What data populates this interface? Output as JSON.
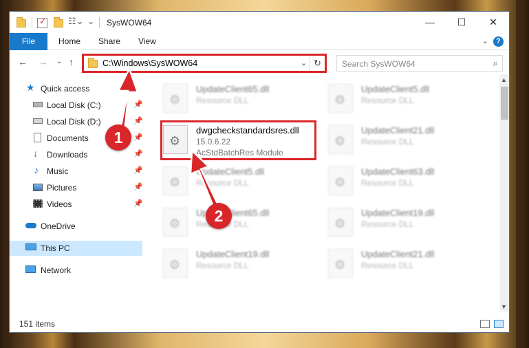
{
  "window": {
    "title": "SysWOW64",
    "controls": {
      "minimize": "—",
      "maximize": "☐",
      "close": "✕"
    }
  },
  "ribbon": {
    "tabs": [
      {
        "label": "File",
        "active": true
      },
      {
        "label": "Home"
      },
      {
        "label": "Share"
      },
      {
        "label": "View"
      }
    ],
    "help": "?",
    "collapse": "⌄"
  },
  "nav": {
    "back": "←",
    "forward": "→",
    "recent": "⌄",
    "up": "↑",
    "address": "C:\\Windows\\SysWOW64",
    "address_dropdown": "⌄",
    "refresh": "↻",
    "search_placeholder": "Search SysWOW64",
    "search_icon": "⌕"
  },
  "sidebar": {
    "items": [
      {
        "label": "Quick access",
        "icon": "star-icon",
        "pinned": false
      },
      {
        "label": "Local Disk (C:)",
        "icon": "drive-icon",
        "pinned": true
      },
      {
        "label": "Local Disk (D:)",
        "icon": "drive-icon",
        "pinned": true
      },
      {
        "label": "Documents",
        "icon": "documents-icon",
        "pinned": true
      },
      {
        "label": "Downloads",
        "icon": "download-icon",
        "pinned": true
      },
      {
        "label": "Music",
        "icon": "music-icon",
        "pinned": true
      },
      {
        "label": "Pictures",
        "icon": "pictures-icon",
        "pinned": true
      },
      {
        "label": "Videos",
        "icon": "videos-icon",
        "pinned": true
      },
      {
        "label": "OneDrive",
        "icon": "cloud-icon",
        "pinned": false
      },
      {
        "label": "This PC",
        "icon": "computer-icon",
        "pinned": false,
        "selected": true
      },
      {
        "label": "Network",
        "icon": "network-icon",
        "pinned": false
      }
    ],
    "pin_glyph": "📌"
  },
  "files": {
    "left": [
      {
        "name": "UpdateClient65.dll",
        "type": "Resource DLL",
        "blurred": true
      },
      {
        "name": "dwgcheckstandardsres.dll",
        "type": "15.0.6.22",
        "desc": "AcStdBatchRes Module",
        "blurred": false
      },
      {
        "name": "UpdateClient5.dll",
        "type": "Resource DLL",
        "blurred": true
      },
      {
        "name": "UpdateClient65.dll",
        "type": "Resource DLL",
        "blurred": true
      },
      {
        "name": "UpdateClient19.dll",
        "type": "Resource DLL",
        "blurred": true
      }
    ],
    "right": [
      {
        "name": "UpdateClient5.dll",
        "type": "Resource DLL",
        "blurred": true
      },
      {
        "name": "UpdateClient21.dll",
        "type": "Resource DLL",
        "blurred": true
      },
      {
        "name": "UpdateClient63.dll",
        "type": "Resource DLL",
        "blurred": true
      },
      {
        "name": "UpdateClient19.dll",
        "type": "Resource DLL",
        "blurred": true
      },
      {
        "name": "UpdateClient21.dll",
        "type": "Resource DLL",
        "blurred": true
      }
    ]
  },
  "status": {
    "item_count": "151 items"
  },
  "callouts": [
    {
      "number": "1"
    },
    {
      "number": "2"
    }
  ],
  "colors": {
    "accent": "#1979ca",
    "highlight": "#d9262a",
    "selected": "#cce8ff"
  }
}
